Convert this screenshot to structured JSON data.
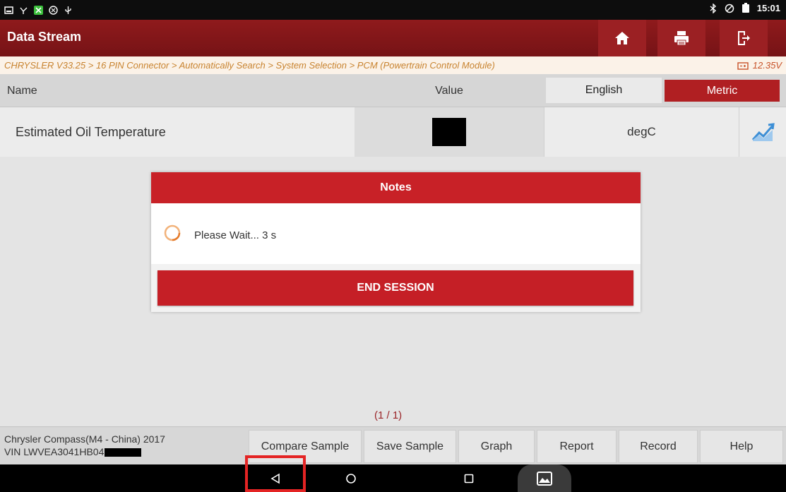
{
  "status_bar": {
    "time": "15:01",
    "left_icons": [
      "screenshot-icon",
      "usb-debug-icon",
      "app-notification-icon",
      "settings-notification-icon",
      "usb-icon"
    ],
    "right_icons": [
      "bluetooth-icon",
      "do-not-disturb-icon",
      "battery-icon"
    ]
  },
  "header": {
    "title": "Data Stream",
    "buttons": [
      "home-icon",
      "print-icon",
      "exit-icon"
    ]
  },
  "breadcrumb": {
    "path": "CHRYSLER V33.25 > 16 PIN Connector > Automatically Search > System Selection > PCM (Powertrain Control Module)",
    "voltage": "12.35V"
  },
  "table": {
    "columns": {
      "name": "Name",
      "value": "Value"
    },
    "unit_toggle": {
      "english": "English",
      "metric": "Metric",
      "selected": "Metric"
    },
    "rows": [
      {
        "name": "Estimated Oil Temperature",
        "value": "",
        "unit": "degC"
      }
    ]
  },
  "pagination": "(1 / 1)",
  "modal": {
    "title": "Notes",
    "message": "Please Wait... 3 s",
    "button": "END SESSION"
  },
  "vehicle": {
    "model": "Chrysler Compass(M4 - China) 2017",
    "vin": "VIN LWVEA3041HB04"
  },
  "toolbar": {
    "compare_sample": "Compare Sample",
    "save_sample": "Save Sample",
    "graph": "Graph",
    "report": "Report",
    "record": "Record",
    "help": "Help"
  },
  "colors": {
    "header_red": "#8f1a1c",
    "accent_red": "#c82127",
    "breadcrumb_orange": "#c8832f"
  }
}
